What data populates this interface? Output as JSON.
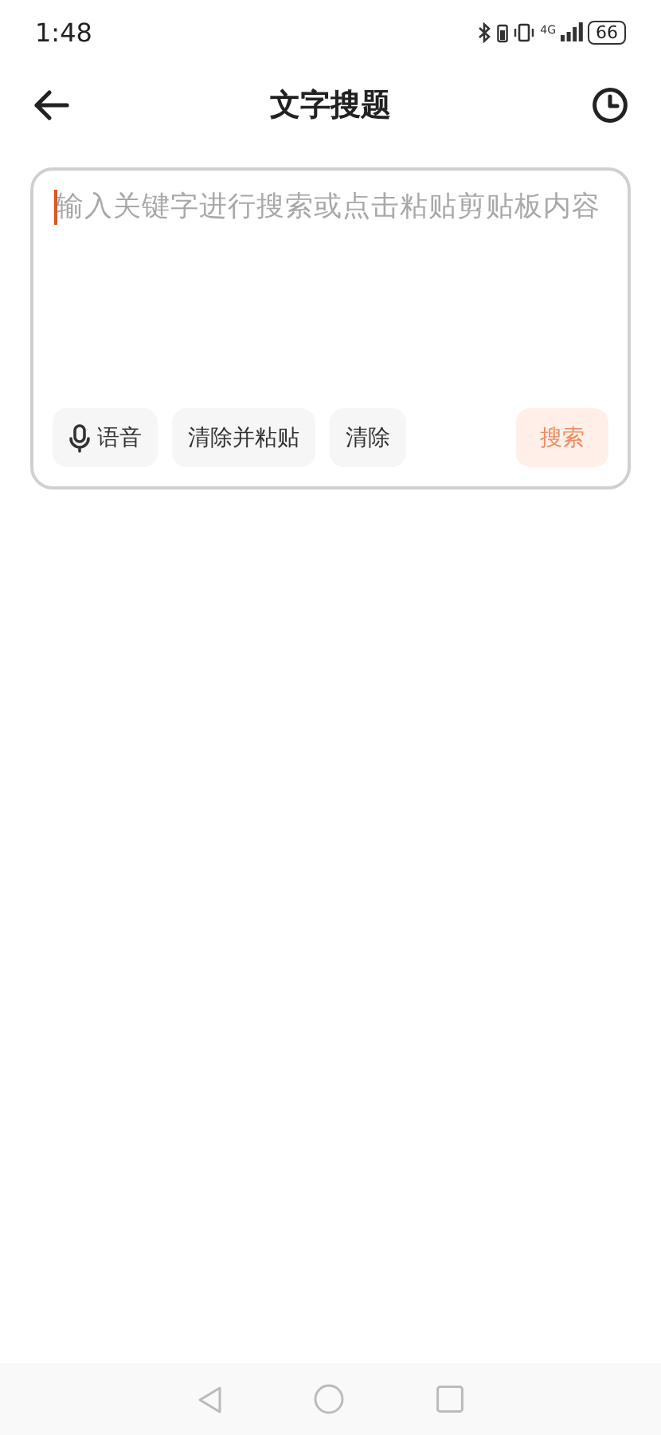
{
  "status_bar": {
    "time": "1:48",
    "network": "4G",
    "battery": "66"
  },
  "header": {
    "title": "文字搜题"
  },
  "search_box": {
    "placeholder": "输入关键字进行搜索或点击粘贴剪贴板内容",
    "actions": [
      {
        "kind": "voice",
        "label": "语音"
      },
      {
        "kind": "text",
        "label": "清除并粘贴"
      },
      {
        "kind": "text",
        "label": "清除"
      }
    ],
    "submit": {
      "label": "搜索",
      "disabled": true
    }
  }
}
